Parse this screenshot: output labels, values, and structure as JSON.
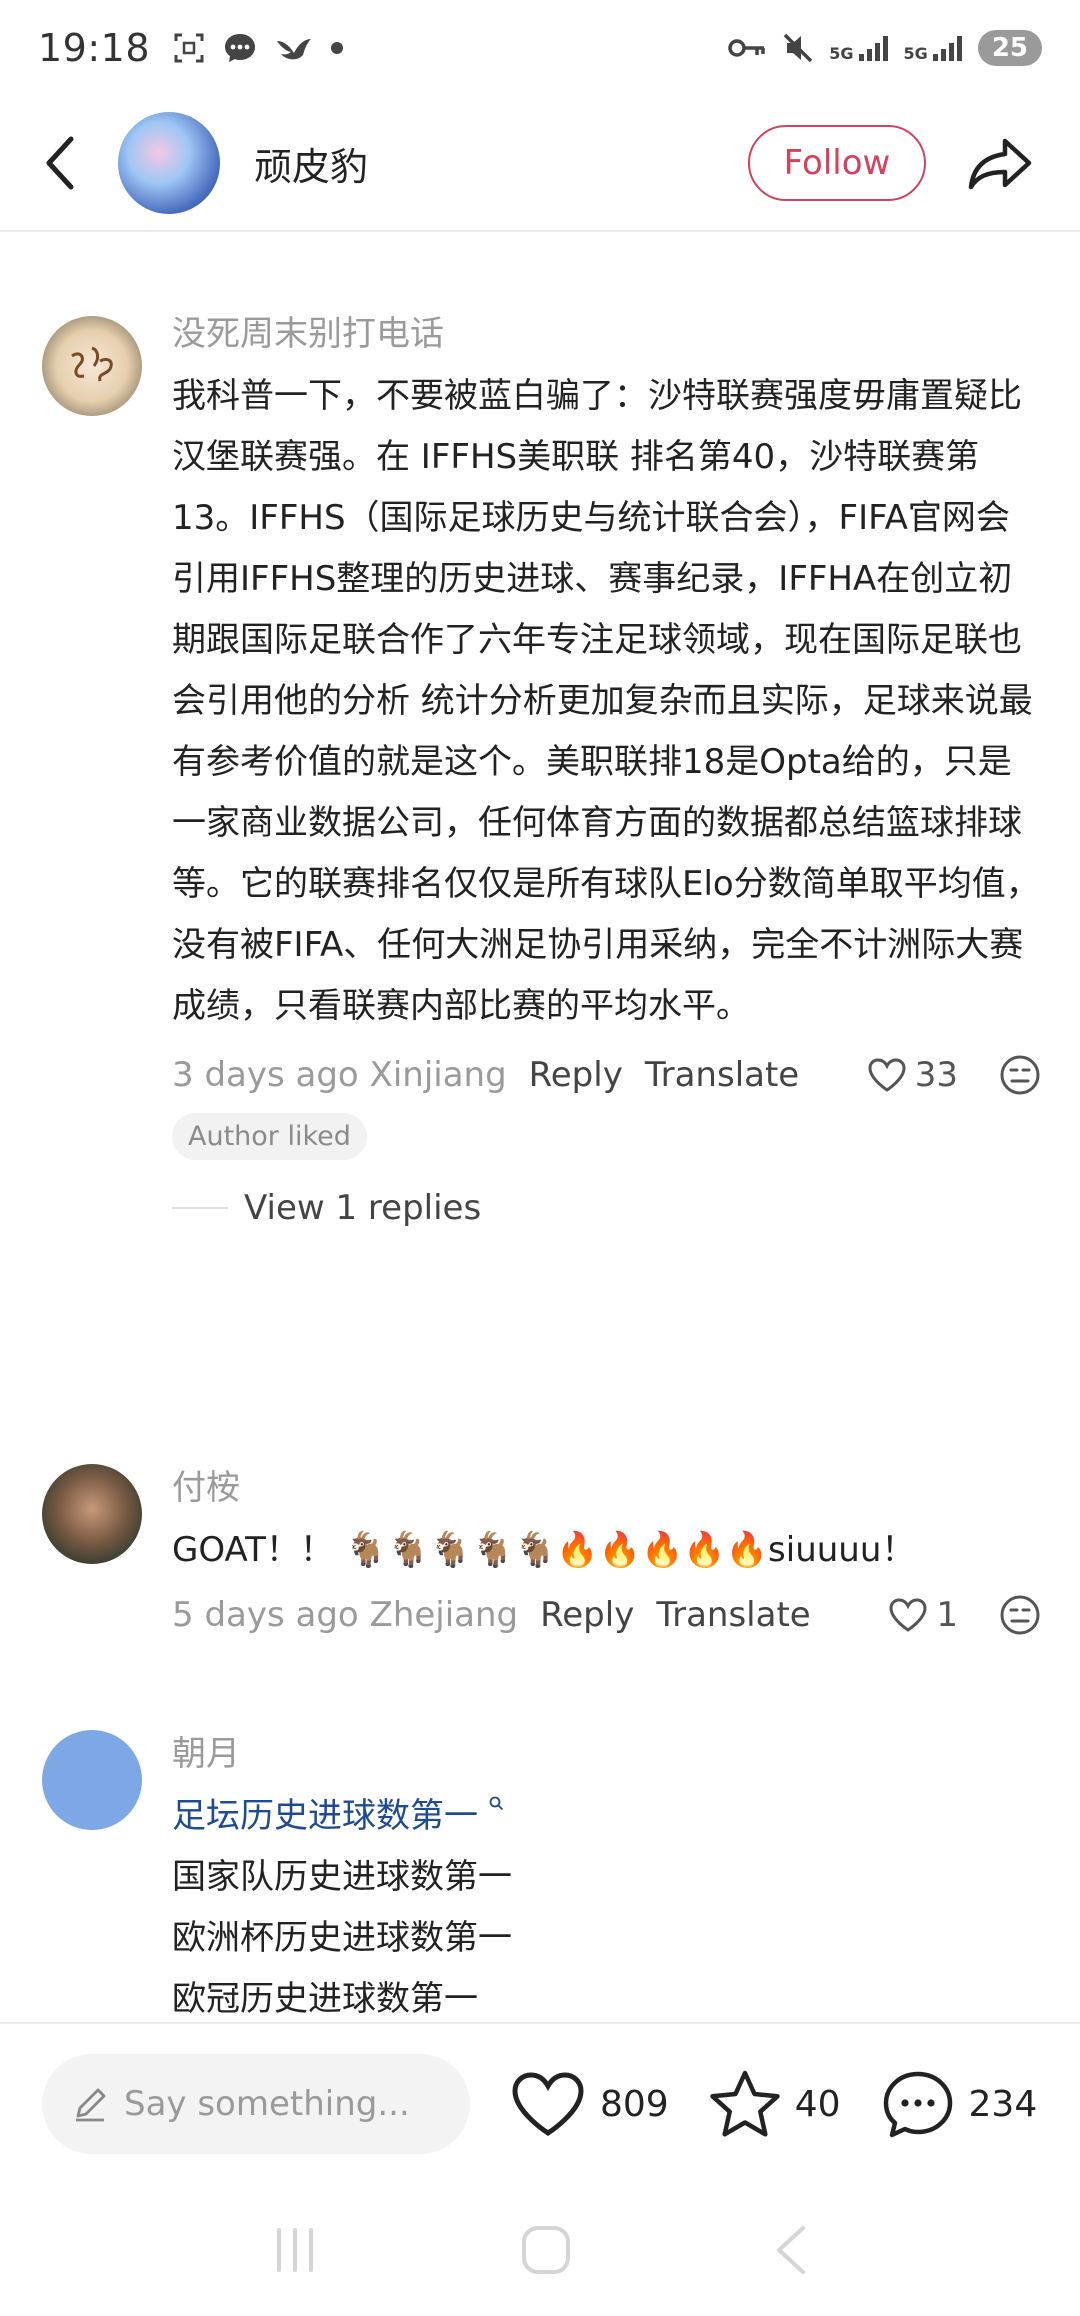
{
  "status_bar": {
    "time": "19:18",
    "network1": "5G",
    "network2": "5G",
    "battery": "25"
  },
  "header": {
    "author_name": "顽皮豹",
    "follow_label": "Follow"
  },
  "comments": [
    {
      "user": "没死周末别打电话",
      "text": "我科普一下，不要被蓝白骗了：沙特联赛强度毋庸置疑比汉堡联赛强。在 IFFHS美职联  排名第40，沙特联赛第13。IFFHS（国际足球历史与统计联合会），FIFA官网会引用IFFHS整理的历史进球、赛事纪录，IFFHA在创立初期跟国际足联合作了六年专注足球领域，现在国际足联也会引用他的分析 统计分析更加复杂而且实际，足球来说最有参考价值的就是这个。美职联排18是Opta给的，只是一家商业数据公司，任何体育方面的数据都总结篮球排球等。它的联赛排名仅仅是所有球队Elo分数简单取平均值，没有被FIFA、任何大洲足协引用采纳，完全不计洲际大赛成绩，只看联赛内部比赛的平均水平。",
      "time_location": "3 days ago Xinjiang",
      "reply_label": "Reply",
      "translate_label": "Translate",
      "likes": "33",
      "author_liked": "Author liked",
      "view_replies": "View 1 replies"
    },
    {
      "user": "付桉",
      "text": "GOAT！！ 🐐🐐🐐🐐🐐🔥🔥🔥🔥🔥siuuuu！",
      "time_location": "5 days ago Zhejiang",
      "reply_label": "Reply",
      "translate_label": "Translate",
      "likes": "1"
    },
    {
      "user": "朝月",
      "linked_line": "足坛历史进球数第一",
      "lines": [
        "国家队历史进球数第一",
        "欧洲杯历史进球数第一",
        "欧冠历史进球数第一"
      ]
    }
  ],
  "bottom_bar": {
    "input_placeholder": "Say something...",
    "likes": "809",
    "favorites": "40",
    "comments": "234"
  },
  "colors": {
    "accent": "#d3415d",
    "link": "#1f4b8f"
  }
}
